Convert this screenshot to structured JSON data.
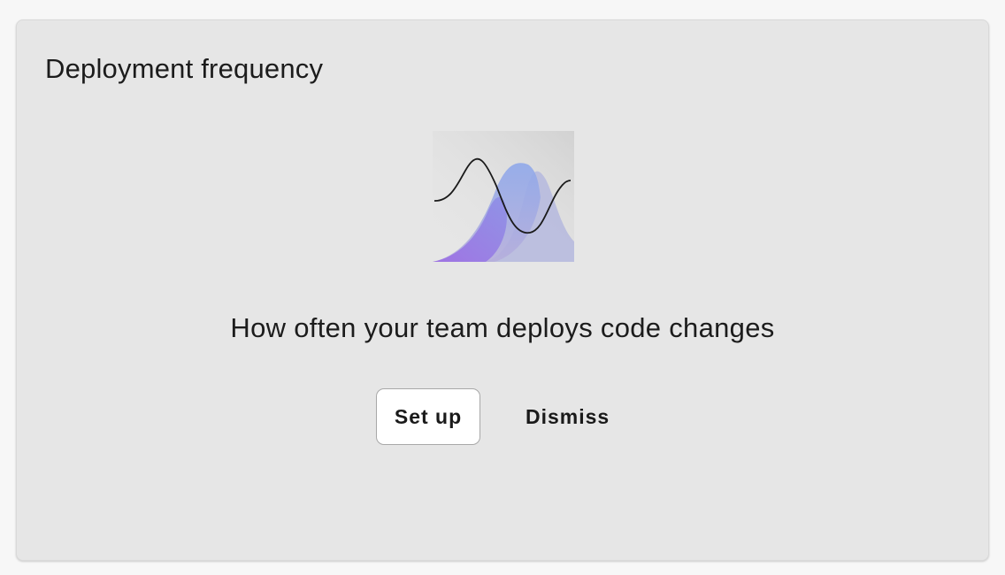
{
  "card": {
    "title": "Deployment frequency",
    "illustration_icon": "bell-curve-wave-illustration",
    "description": "How often your team deploys code changes",
    "primary_button": "Set up",
    "secondary_button": "Dismiss"
  },
  "colors": {
    "page_background": "#f7f7f7",
    "card_background": "#e6e6e6",
    "text": "#1c1c1c",
    "button_background": "#ffffff",
    "curve_purple": "#9b6fe6",
    "curve_blue": "#8aa4e8"
  }
}
